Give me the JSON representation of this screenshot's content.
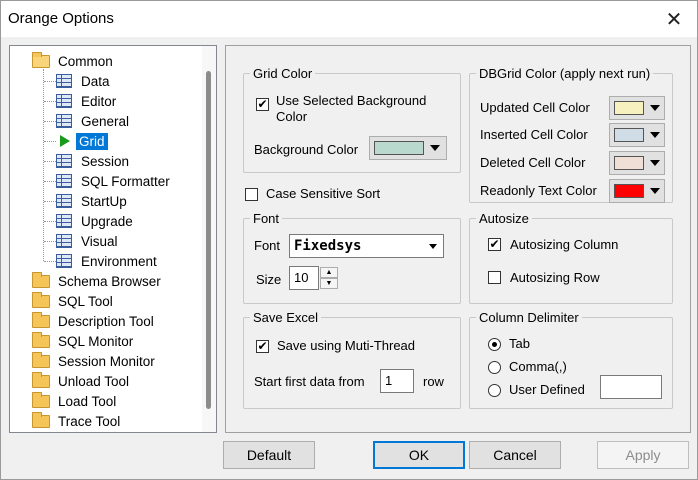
{
  "window": {
    "title": "Orange Options"
  },
  "tree": {
    "items": [
      {
        "label": "Common",
        "level": 0,
        "icon": "folder-open-icon"
      },
      {
        "label": "Data",
        "level": 1,
        "icon": "grid-icon"
      },
      {
        "label": "Editor",
        "level": 1,
        "icon": "grid-icon"
      },
      {
        "label": "General",
        "level": 1,
        "icon": "grid-icon"
      },
      {
        "label": "Grid",
        "level": 1,
        "icon": "arrow-icon",
        "selected": true
      },
      {
        "label": "Session",
        "level": 1,
        "icon": "grid-icon"
      },
      {
        "label": "SQL Formatter",
        "level": 1,
        "icon": "grid-icon"
      },
      {
        "label": "StartUp",
        "level": 1,
        "icon": "grid-icon"
      },
      {
        "label": "Upgrade",
        "level": 1,
        "icon": "grid-icon"
      },
      {
        "label": "Visual",
        "level": 1,
        "icon": "grid-icon"
      },
      {
        "label": "Environment",
        "level": 1,
        "icon": "grid-icon"
      },
      {
        "label": "Schema Browser",
        "level": 0,
        "icon": "folder-icon"
      },
      {
        "label": "SQL Tool",
        "level": 0,
        "icon": "folder-icon"
      },
      {
        "label": "Description Tool",
        "level": 0,
        "icon": "folder-icon"
      },
      {
        "label": "SQL Monitor",
        "level": 0,
        "icon": "folder-icon"
      },
      {
        "label": "Session Monitor",
        "level": 0,
        "icon": "folder-icon"
      },
      {
        "label": "Unload Tool",
        "level": 0,
        "icon": "folder-icon"
      },
      {
        "label": "Load Tool",
        "level": 0,
        "icon": "folder-icon"
      },
      {
        "label": "Trace Tool",
        "level": 0,
        "icon": "folder-icon"
      }
    ]
  },
  "grid_color": {
    "legend": "Grid Color",
    "use_selected_label_1": "Use Selected Background",
    "use_selected_label_2": "Color",
    "use_selected_checked": true,
    "background_label": "Background Color",
    "background_color": "#b9d9cf"
  },
  "case_sensitive": {
    "label": "Case Sensitive Sort",
    "checked": false
  },
  "dbgrid_color": {
    "legend": "DBGrid Color (apply next run)",
    "rows": [
      {
        "label": "Updated Cell Color",
        "color": "#f7f1c0"
      },
      {
        "label": "Inserted Cell Color",
        "color": "#d0dde6"
      },
      {
        "label": "Deleted Cell Color",
        "color": "#efdfd6"
      },
      {
        "label": "Readonly Text Color",
        "color": "#ff0000"
      }
    ]
  },
  "font": {
    "legend": "Font",
    "font_label": "Font",
    "font_value": "Fixedsys",
    "size_label": "Size",
    "size_value": "10"
  },
  "autosize": {
    "legend": "Autosize",
    "column_label": "Autosizing Column",
    "column_checked": true,
    "row_label": "Autosizing Row",
    "row_checked": false
  },
  "save_excel": {
    "legend": "Save Excel",
    "multithread_label": "Save using Muti-Thread",
    "multithread_checked": true,
    "start_label": "Start first data from",
    "start_value": "1",
    "row_suffix": "row"
  },
  "column_delimiter": {
    "legend": "Column Delimiter",
    "options": [
      {
        "label": "Tab",
        "selected": true
      },
      {
        "label": "Comma(,)",
        "selected": false
      },
      {
        "label": "User Defined",
        "selected": false
      }
    ],
    "user_defined_value": ""
  },
  "buttons": {
    "default_label": "Default",
    "ok_label": "OK",
    "cancel_label": "Cancel",
    "apply_label": "Apply"
  }
}
